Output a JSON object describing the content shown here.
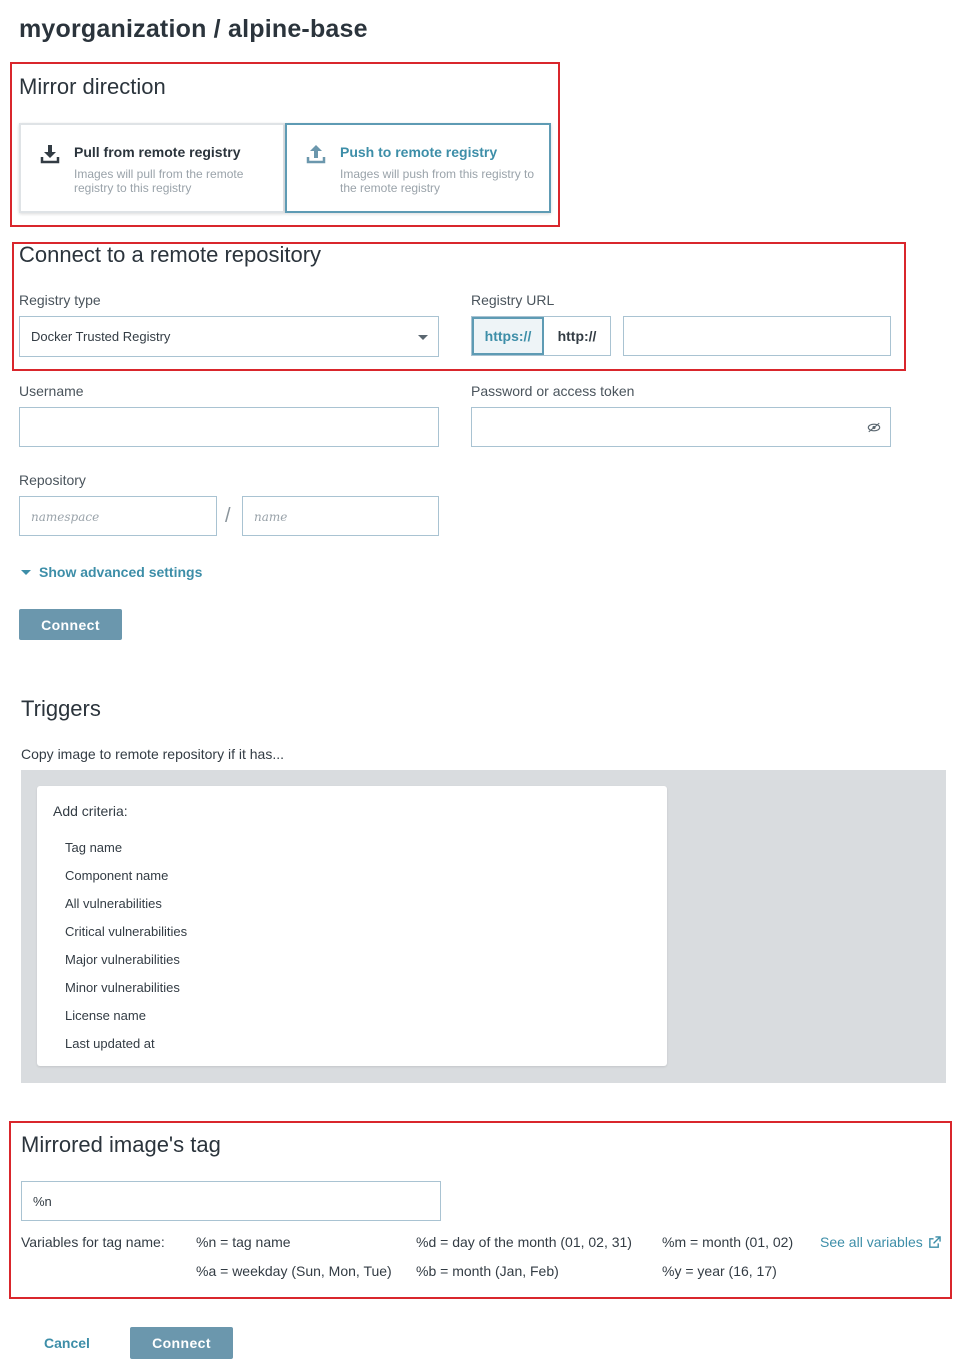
{
  "header": {
    "title": "myorganization / alpine-base"
  },
  "mirror_direction": {
    "heading": "Mirror direction",
    "options": [
      {
        "title": "Pull from remote registry",
        "description": "Images will pull from the remote registry to this registry",
        "icon": "download-icon",
        "selected": false
      },
      {
        "title": "Push to remote registry",
        "description": "Images will push from this registry to the remote registry",
        "icon": "upload-icon",
        "selected": true
      }
    ]
  },
  "connect": {
    "heading": "Connect to a remote repository",
    "registry_type_label": "Registry type",
    "registry_type_value": "Docker Trusted Registry",
    "registry_url_label": "Registry URL",
    "protocols": [
      "https://",
      "http://"
    ],
    "selected_protocol": "https://",
    "registry_url_value": "",
    "username_label": "Username",
    "username_value": "",
    "password_label": "Password or access token",
    "password_value": "",
    "repository_label": "Repository",
    "namespace_placeholder": "namespace",
    "separator": "/",
    "name_placeholder": "name",
    "advanced_label": "Show advanced settings",
    "connect_label": "Connect"
  },
  "triggers": {
    "heading": "Triggers",
    "intro": "Copy image to remote repository if it has...",
    "add_criteria_label": "Add criteria:",
    "criteria": [
      "Tag name",
      "Component name",
      "All vulnerabilities",
      "Critical vulnerabilities",
      "Major vulnerabilities",
      "Minor vulnerabilities",
      "License name",
      "Last updated at"
    ]
  },
  "mirrored_tag": {
    "heading": "Mirrored image's tag",
    "value": "%n",
    "variables_label": "Variables for tag name:",
    "variables": [
      "%n = tag name",
      "%d = day of the month (01, 02, 31)",
      "%m = month (01, 02)",
      "%a = weekday (Sun, Mon, Tue)",
      "%b = month (Jan, Feb)",
      "%y = year (16, 17)"
    ],
    "see_all_label": "See all variables"
  },
  "footer": {
    "cancel_label": "Cancel",
    "connect_label": "Connect"
  },
  "colors": {
    "accent": "#3d8ea8",
    "button": "#6b97ad",
    "highlight_border": "#d9262c",
    "panel_gray": "#d9dcdf"
  }
}
